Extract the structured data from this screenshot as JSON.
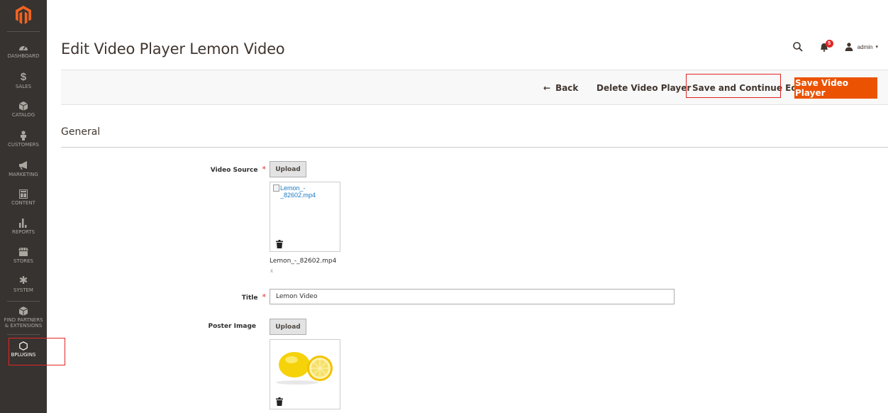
{
  "sidebar": {
    "items": [
      {
        "label": "DASHBOARD",
        "icon": "dashboard-icon"
      },
      {
        "label": "SALES",
        "icon": "dollar-icon"
      },
      {
        "label": "CATALOG",
        "icon": "box-icon"
      },
      {
        "label": "CUSTOMERS",
        "icon": "person-icon"
      },
      {
        "label": "MARKETING",
        "icon": "megaphone-icon"
      },
      {
        "label": "CONTENT",
        "icon": "layout-icon"
      },
      {
        "label": "REPORTS",
        "icon": "bar-chart-icon"
      },
      {
        "label": "STORES",
        "icon": "store-icon"
      },
      {
        "label": "SYSTEM",
        "icon": "gear-icon"
      },
      {
        "label_line1": "FIND PARTNERS",
        "label_line2": "& EXTENSIONS",
        "icon": "cube-icon"
      },
      {
        "label": "BPLUGINS",
        "icon": "hexagon-icon"
      }
    ]
  },
  "header": {
    "title": "Edit Video Player Lemon Video",
    "notification_count": "5",
    "user": "admin"
  },
  "actions": {
    "back": "Back",
    "delete": "Delete Video Player",
    "save_continue": "Save and Continue Edit",
    "save": "Save Video Player"
  },
  "section": {
    "title": "General"
  },
  "form": {
    "video_source": {
      "label": "Video Source",
      "required_mark": "*",
      "upload_label": "Upload",
      "preview_alt_line1": "Lemon_-",
      "preview_alt_line2": "_82602.mp4",
      "file_name": "Lemon_-_82602.mp4",
      "remove_label": "x"
    },
    "title": {
      "label": "Title",
      "required_mark": "*",
      "value": "Lemon Video"
    },
    "poster_image": {
      "label": "Poster Image",
      "upload_label": "Upload"
    }
  },
  "colors": {
    "sidebar_bg": "#373330",
    "accent": "#eb5202",
    "highlight": "#e22626"
  }
}
